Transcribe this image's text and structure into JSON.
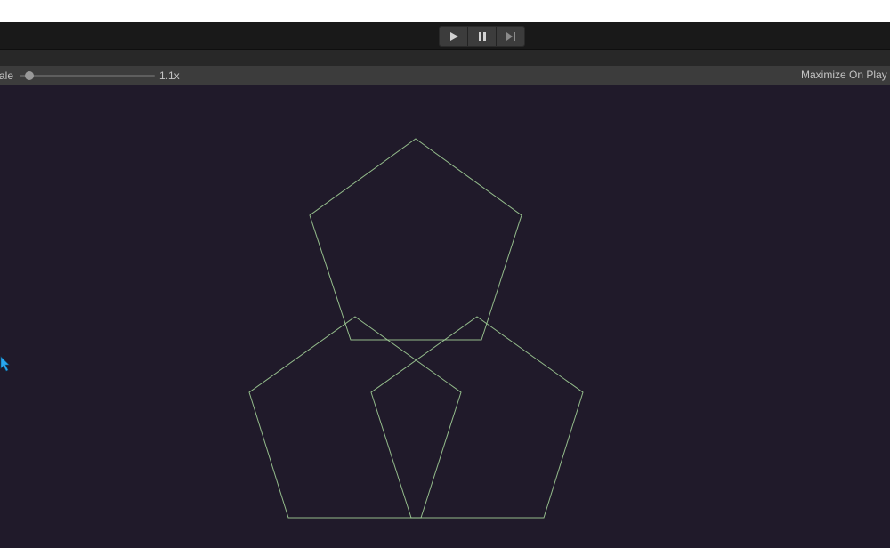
{
  "toolbar": {
    "play_icon": "play-icon",
    "pause_icon": "pause-icon",
    "step_icon": "step-icon"
  },
  "game_toolbar": {
    "scale_label": "ale",
    "scale_value": "1.1x",
    "scale_fraction": 0.07,
    "maximize_label": "Maximize On Play"
  },
  "colors": {
    "game_background": "#201a2a",
    "shape_stroke": "#a8d89c",
    "cursor": "#2aa8f0"
  },
  "scene": {
    "shapes": [
      "pentagon-top",
      "pentagon-bottom-left",
      "pentagon-bottom-right"
    ],
    "cursor_icon": "pointer-cursor-icon"
  }
}
